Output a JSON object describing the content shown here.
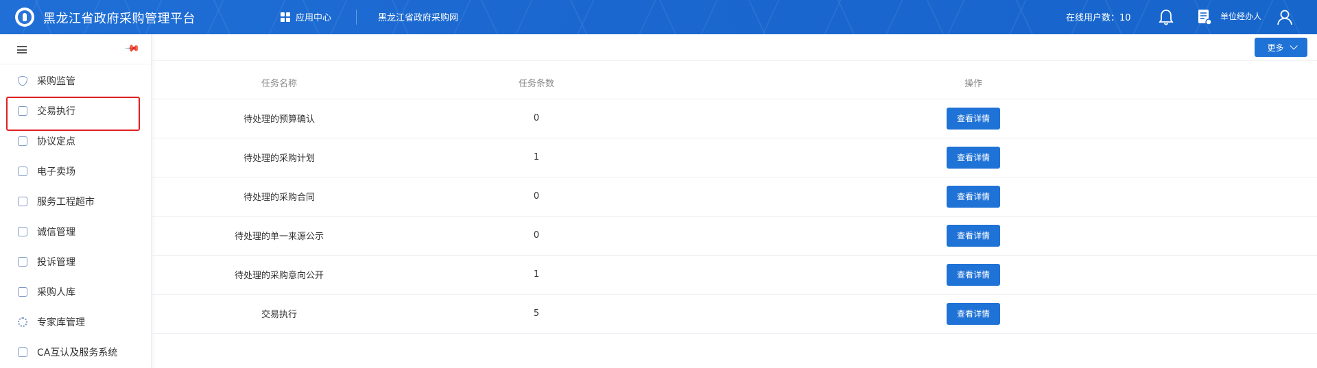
{
  "header": {
    "title": "黑龙江省政府采购管理平台",
    "apps_label": "应用中心",
    "portal_link": "黑龙江省政府采购网",
    "online_users": "在线用户数：10",
    "role": "单位经办人"
  },
  "sidebar": {
    "items": [
      {
        "label": "采购监管",
        "icon": "shield-icon"
      },
      {
        "label": "交易执行",
        "icon": "clipboard-icon"
      },
      {
        "label": "协议定点",
        "icon": "store-icon"
      },
      {
        "label": "电子卖场",
        "icon": "store-icon"
      },
      {
        "label": "服务工程超市",
        "icon": "store-icon"
      },
      {
        "label": "诚信管理",
        "icon": "id-card-icon"
      },
      {
        "label": "投诉管理",
        "icon": "complaint-icon"
      },
      {
        "label": "采购人库",
        "icon": "calendar-icon"
      },
      {
        "label": "专家库管理",
        "icon": "gear-icon"
      },
      {
        "label": "CA互认及服务系统",
        "icon": "certificate-icon"
      }
    ]
  },
  "toolbar": {
    "more_label": "更多"
  },
  "table": {
    "headers": [
      "任务名称",
      "任务条数",
      "操作"
    ],
    "rows": [
      {
        "name": "待处理的预算确认",
        "count": "0",
        "action": "查看详情"
      },
      {
        "name": "待处理的采购计划",
        "count": "1",
        "action": "查看详情"
      },
      {
        "name": "待处理的采购合同",
        "count": "0",
        "action": "查看详情"
      },
      {
        "name": "待处理的单一来源公示",
        "count": "0",
        "action": "查看详情"
      },
      {
        "name": "待处理的采购意向公开",
        "count": "1",
        "action": "查看详情"
      },
      {
        "name": "交易执行",
        "count": "5",
        "action": "查看详情"
      }
    ]
  },
  "colors": {
    "primary": "#1f72d6",
    "highlight": "#e02020"
  }
}
